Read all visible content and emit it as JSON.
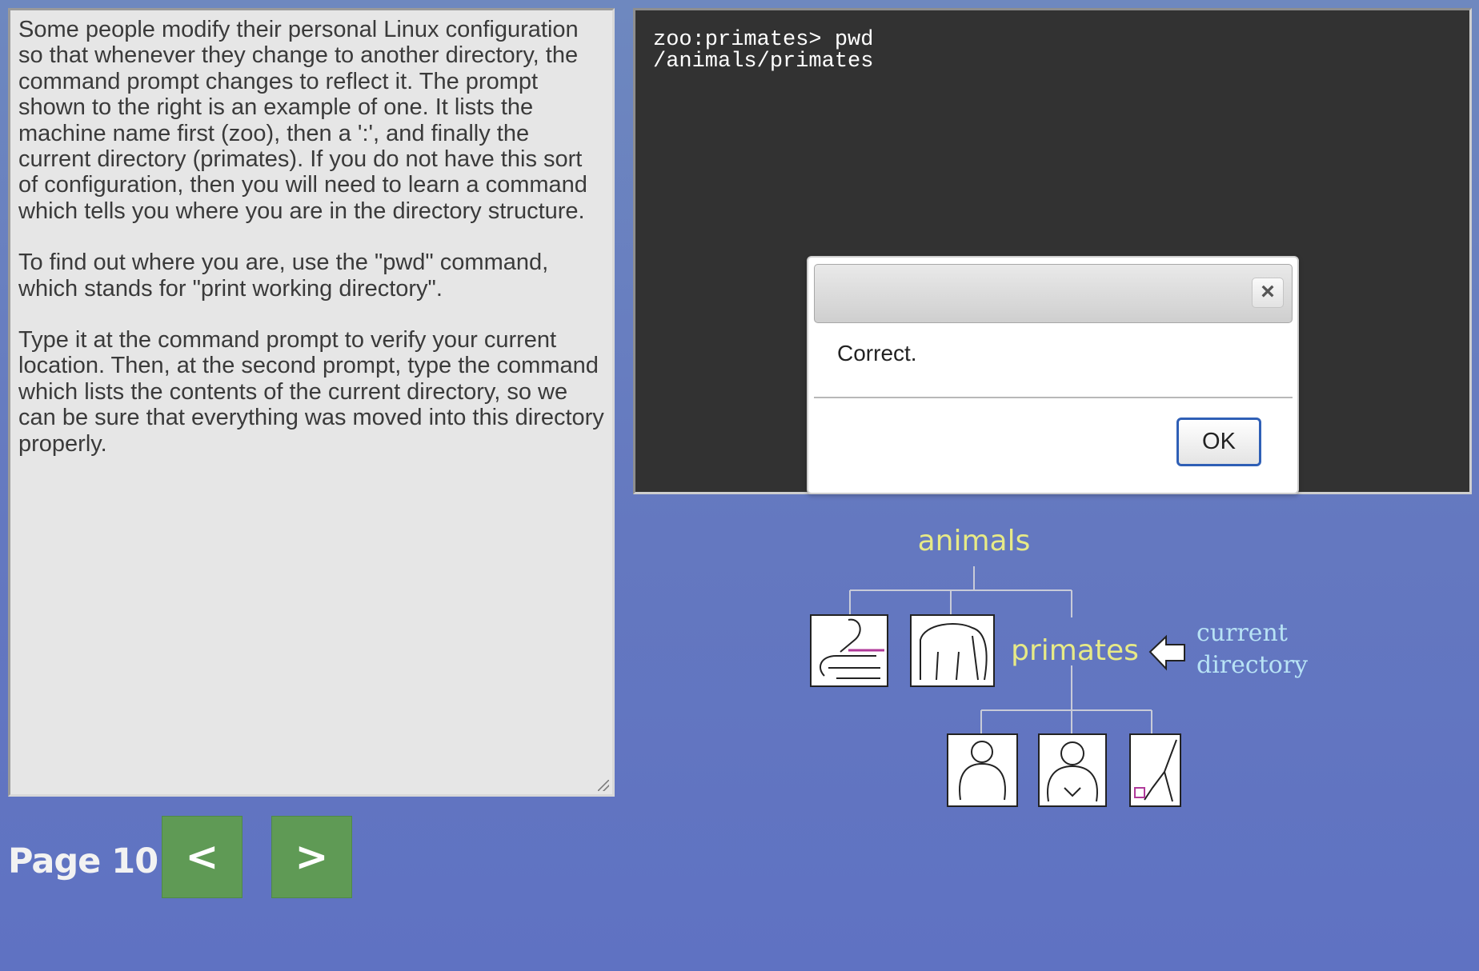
{
  "lesson": {
    "paragraphs": [
      "Some people modify their personal Linux configuration so that whenever they change to another directory, the command prompt changes to reflect it. The prompt shown to the right is an example of one. It lists the machine name first (zoo), then a ':', and finally the current directory (primates). If you do not have this sort of configuration, then you will need to learn a command which tells you where you are in the directory structure.",
      "To find out where you are, use the \"pwd\" command, which stands for \"print working directory\".",
      "Type it at the command prompt to verify your current location. Then, at the second prompt, type the command which lists the contents of the current directory, so we can be sure that everything was moved into this directory properly."
    ]
  },
  "terminal": {
    "lines": [
      "zoo:primates> pwd",
      "/animals/primates"
    ]
  },
  "dialog": {
    "title": "",
    "message": "Correct.",
    "close_glyph": "×",
    "ok_label": "OK"
  },
  "navigation": {
    "page_label": "Page 10",
    "prev_label": "<",
    "next_label": ">"
  },
  "tree": {
    "root": "animals",
    "current": "primates",
    "current_marker_line1": "current",
    "current_marker_line2": "directory",
    "siblings_icons": [
      "snake-icon",
      "elephant-icon"
    ],
    "children_icons": [
      "monkey-icon",
      "gorilla-icon",
      "gibbon-icon"
    ],
    "colors": {
      "folder_label": "#e7ea86",
      "current_label": "#b8e3f5",
      "lines": "#c8cbd8"
    }
  }
}
